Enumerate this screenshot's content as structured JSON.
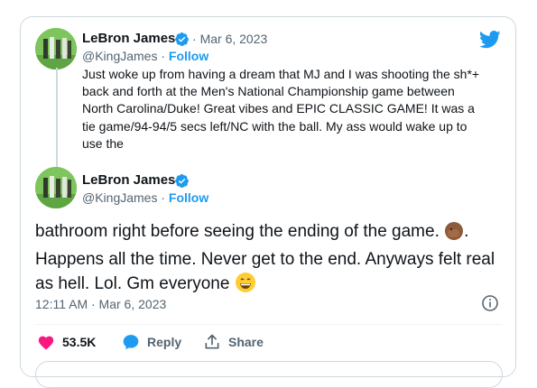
{
  "quoted": {
    "author_name": "LeBron James",
    "handle": "@KingJames",
    "separator": "·",
    "date": "Mar 6, 2023",
    "follow_label": "Follow",
    "text": "Just woke up from having a dream that MJ and I was shooting the sh*+ back and forth at the Men's National Championship game between North Carolina/Duke! Great vibes and EPIC CLASSIC GAME! It was a tie game/94-94/5 secs left/NC with the ball. My ass would wake up to use the"
  },
  "main": {
    "author_name": "LeBron James",
    "handle": "@KingJames",
    "separator": "·",
    "follow_label": "Follow",
    "text_part1": "bathroom right before seeing the ending of the game. ",
    "text_part2": ". Happens all the time. Never get to the end. Anyways felt real as hell. Lol. Gm everyone ",
    "timestamp": "12:11 AM · Mar 6, 2023"
  },
  "actions": {
    "likes": "53.5K",
    "reply_label": "Reply",
    "share_label": "Share"
  },
  "colors": {
    "accent": "#1d9bf0",
    "like": "#f91880",
    "text": "#0f1419",
    "muted": "#536471",
    "border": "#cfd9de"
  },
  "icons": [
    "twitter-bird-icon",
    "verified-badge-icon",
    "facepalm-emoji-icon",
    "grinning-emoji-icon",
    "info-icon",
    "heart-icon",
    "reply-bubble-icon",
    "share-icon"
  ]
}
